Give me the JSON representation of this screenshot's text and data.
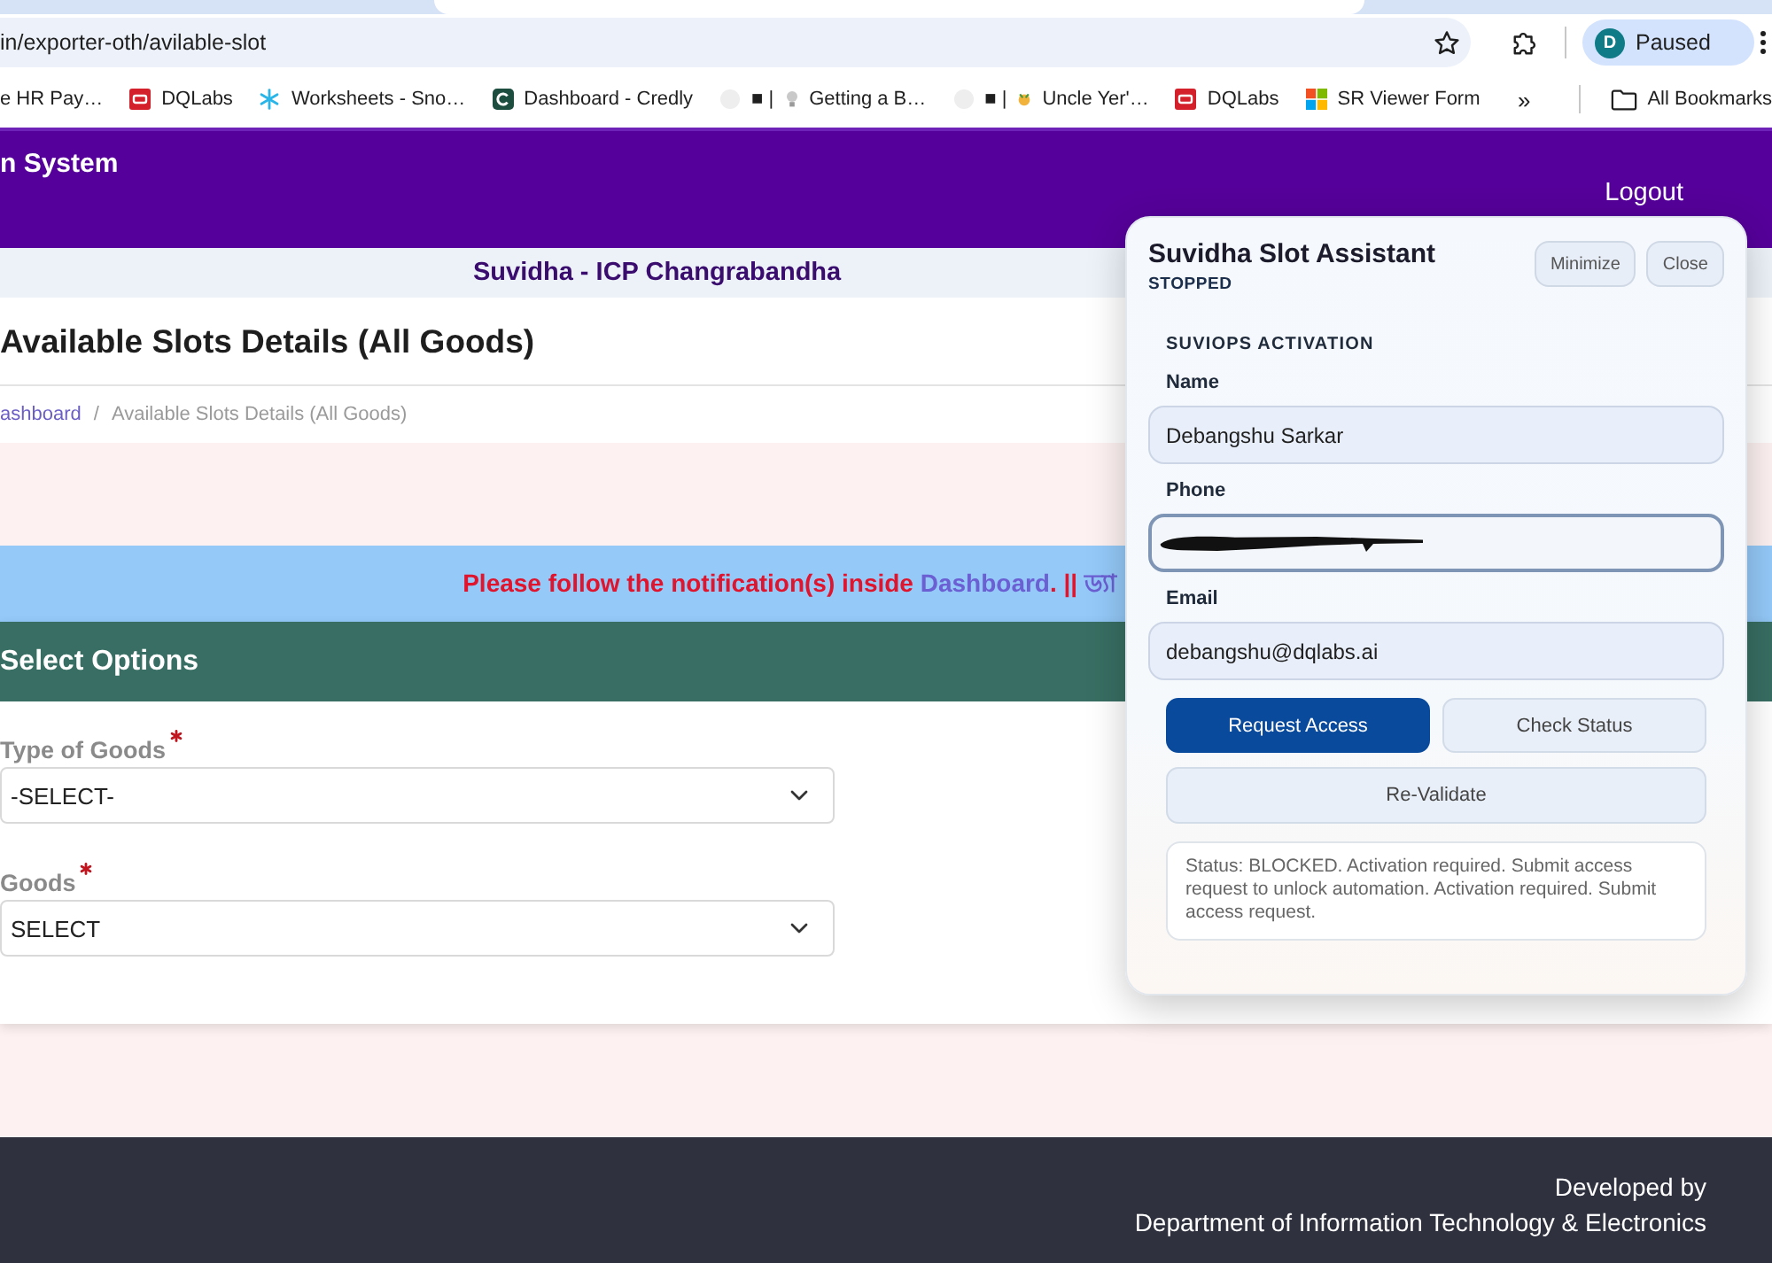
{
  "browser": {
    "tabs": [
      {
        "selected": true
      }
    ],
    "url": "in/exporter-oth/avilable-slot",
    "profile": {
      "initial": "D",
      "label": "Paused"
    },
    "bookmarks": [
      {
        "kind": "text",
        "label": "e HR Pay…"
      },
      {
        "kind": "tile",
        "label": "DQLabs"
      },
      {
        "kind": "snowflake",
        "label": "Worksheets - Sno…"
      },
      {
        "kind": "ring",
        "label": "Dashboard - Credly"
      },
      {
        "kind": "bulb",
        "prefix": "■ |",
        "label": "Getting a B…"
      },
      {
        "kind": "emoji",
        "prefix": "■ |",
        "label": "Uncle Yer'…"
      },
      {
        "kind": "tile",
        "label": "DQLabs"
      },
      {
        "kind": "grid",
        "label": "SR Viewer Form"
      }
    ],
    "overflow": "»",
    "all_bookmarks": "All Bookmarks"
  },
  "header": {
    "title": "n System",
    "logout": "Logout"
  },
  "site_name": "Suvidha - ICP Changrabandha",
  "page_title": "Available Slots Details (All Goods)",
  "breadcrumb": {
    "separator": "/",
    "items": [
      {
        "kind": "link",
        "label": "ashboard"
      },
      {
        "kind": "current",
        "label": "Available Slots Details (All Goods)"
      }
    ]
  },
  "notification": [
    {
      "kind": "alert",
      "text": "Please follow the notification(s) inside "
    },
    {
      "kind": "link",
      "text": "Dashboard"
    },
    {
      "kind": "alert",
      "text": ". || "
    },
    {
      "kind": "link",
      "text": "ড্যা"
    }
  ],
  "form": {
    "title": "Select Options",
    "fields": [
      {
        "label": "Type of Goods",
        "required": true,
        "value": "-SELECT-"
      },
      {
        "label": "Goods",
        "required": true,
        "value": "SELECT"
      }
    ]
  },
  "assistant": {
    "title": "Suvidha Slot Assistant",
    "status": "STOPPED",
    "buttons": [
      {
        "label": "Minimize"
      },
      {
        "label": "Close"
      }
    ],
    "section_title": "SUVIOPS ACTIVATION",
    "fields": [
      {
        "label": "Name",
        "value": "Debangshu Sarkar",
        "focused": false,
        "redacted": false
      },
      {
        "label": "Phone",
        "focused": true,
        "redacted": true
      },
      {
        "label": "Email",
        "value": "debangshu@dqlabs.ai",
        "focused": false,
        "redacted": false
      }
    ],
    "actions": [
      {
        "label": "Request Access",
        "kind": "primary"
      },
      {
        "label": "Check Status",
        "kind": "secondary"
      },
      {
        "label": "Re-Validate",
        "kind": "wide"
      }
    ],
    "message": "Status: BLOCKED. Activation required. Submit access request to unlock automation. Activation required. Submit access request."
  },
  "footer": [
    "Developed by",
    "Department of Information Technology & Electronics"
  ]
}
